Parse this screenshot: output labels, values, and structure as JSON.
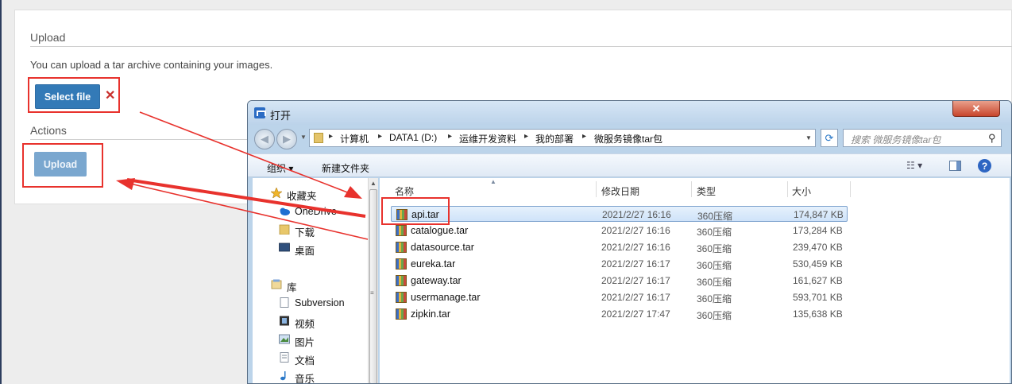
{
  "page": {
    "upload_title": "Upload",
    "upload_description": "You can upload a tar archive containing your images.",
    "select_file_label": "Select file",
    "clear_symbol": "✕",
    "actions_title": "Actions",
    "upload_label": "Upload"
  },
  "dialog": {
    "title": "打开",
    "close_symbol": "✕",
    "breadcrumbs": [
      "计算机",
      "DATA1 (D:)",
      "运维开发资料",
      "我的部署",
      "微服务镜像tar包"
    ],
    "search_placeholder": "搜索 微服务镜像tar包",
    "toolbar": {
      "organize": "组织 ▾",
      "new_folder": "新建文件夹",
      "help": "?"
    },
    "nav_items": [
      {
        "label": "收藏夹",
        "icon": "star-icon"
      },
      {
        "label": "OneDrive",
        "icon": "cloud-icon"
      },
      {
        "label": "下载",
        "icon": "folder-icon"
      },
      {
        "label": "桌面",
        "icon": "desktop-icon"
      },
      {
        "label": "库",
        "icon": "library-icon"
      },
      {
        "label": "Subversion",
        "icon": "document-icon"
      },
      {
        "label": "视频",
        "icon": "film-icon"
      },
      {
        "label": "图片",
        "icon": "picture-icon"
      },
      {
        "label": "文档",
        "icon": "document-icon"
      },
      {
        "label": "音乐",
        "icon": "music-icon"
      }
    ],
    "columns": [
      "名称",
      "修改日期",
      "类型",
      "大小"
    ],
    "files": [
      {
        "name": "api.tar",
        "date": "2021/2/27 16:16",
        "type": "360压缩",
        "size": "174,847 KB",
        "selected": true
      },
      {
        "name": "catalogue.tar",
        "date": "2021/2/27 16:16",
        "type": "360压缩",
        "size": "173,284 KB"
      },
      {
        "name": "datasource.tar",
        "date": "2021/2/27 16:16",
        "type": "360压缩",
        "size": "239,470 KB"
      },
      {
        "name": "eureka.tar",
        "date": "2021/2/27 16:17",
        "type": "360压缩",
        "size": "530,459 KB"
      },
      {
        "name": "gateway.tar",
        "date": "2021/2/27 16:17",
        "type": "360压缩",
        "size": "161,627 KB"
      },
      {
        "name": "usermanage.tar",
        "date": "2021/2/27 16:17",
        "type": "360压缩",
        "size": "593,701 KB"
      },
      {
        "name": "zipkin.tar",
        "date": "2021/2/27 17:47",
        "type": "360压缩",
        "size": "135,638 KB"
      }
    ]
  },
  "colors": {
    "primary_button": "#337ab7",
    "highlight": "#e8322d"
  }
}
